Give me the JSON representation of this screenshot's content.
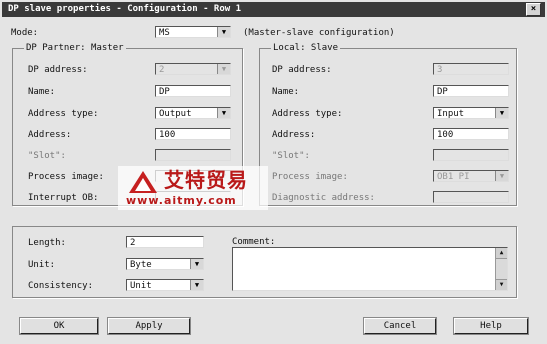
{
  "window": {
    "title": "DP slave properties - Configuration - Row 1",
    "close_glyph": "×"
  },
  "top": {
    "mode_label": "Mode:",
    "mode_value": "MS",
    "mode_note": "(Master-slave configuration)"
  },
  "master": {
    "group_title": "DP Partner: Master",
    "dp_address_label": "DP address:",
    "dp_address_value": "2",
    "name_label": "Name:",
    "name_value": "DP",
    "address_type_label": "Address type:",
    "address_type_value": "Output",
    "address_label": "Address:",
    "address_value": "100",
    "slot_label": "\"Slot\":",
    "process_image_label": "Process image:",
    "interrupt_ob_label": "Interrupt OB:"
  },
  "local": {
    "group_title": "Local: Slave",
    "dp_address_label": "DP address:",
    "dp_address_value": "3",
    "name_label": "Name:",
    "name_value": "DP",
    "address_type_label": "Address type:",
    "address_type_value": "Input",
    "address_label": "Address:",
    "address_value": "100",
    "slot_label": "\"Slot\":",
    "process_image_label": "Process image:",
    "process_image_value": "OB1 PI",
    "diagnostic_label": "Diagnostic address:"
  },
  "bottom": {
    "length_label": "Length:",
    "length_value": "2",
    "unit_label": "Unit:",
    "unit_value": "Byte",
    "consistency_label": "Consistency:",
    "consistency_value": "Unit",
    "comment_label": "Comment:"
  },
  "buttons": {
    "ok": "OK",
    "apply": "Apply",
    "cancel": "Cancel",
    "help": "Help"
  },
  "watermark": {
    "brand": "艾特贸易",
    "url": "www.aitmy.com"
  },
  "icons": {
    "dropdown": "▼",
    "scroll_up": "▲",
    "scroll_down": "▼"
  }
}
